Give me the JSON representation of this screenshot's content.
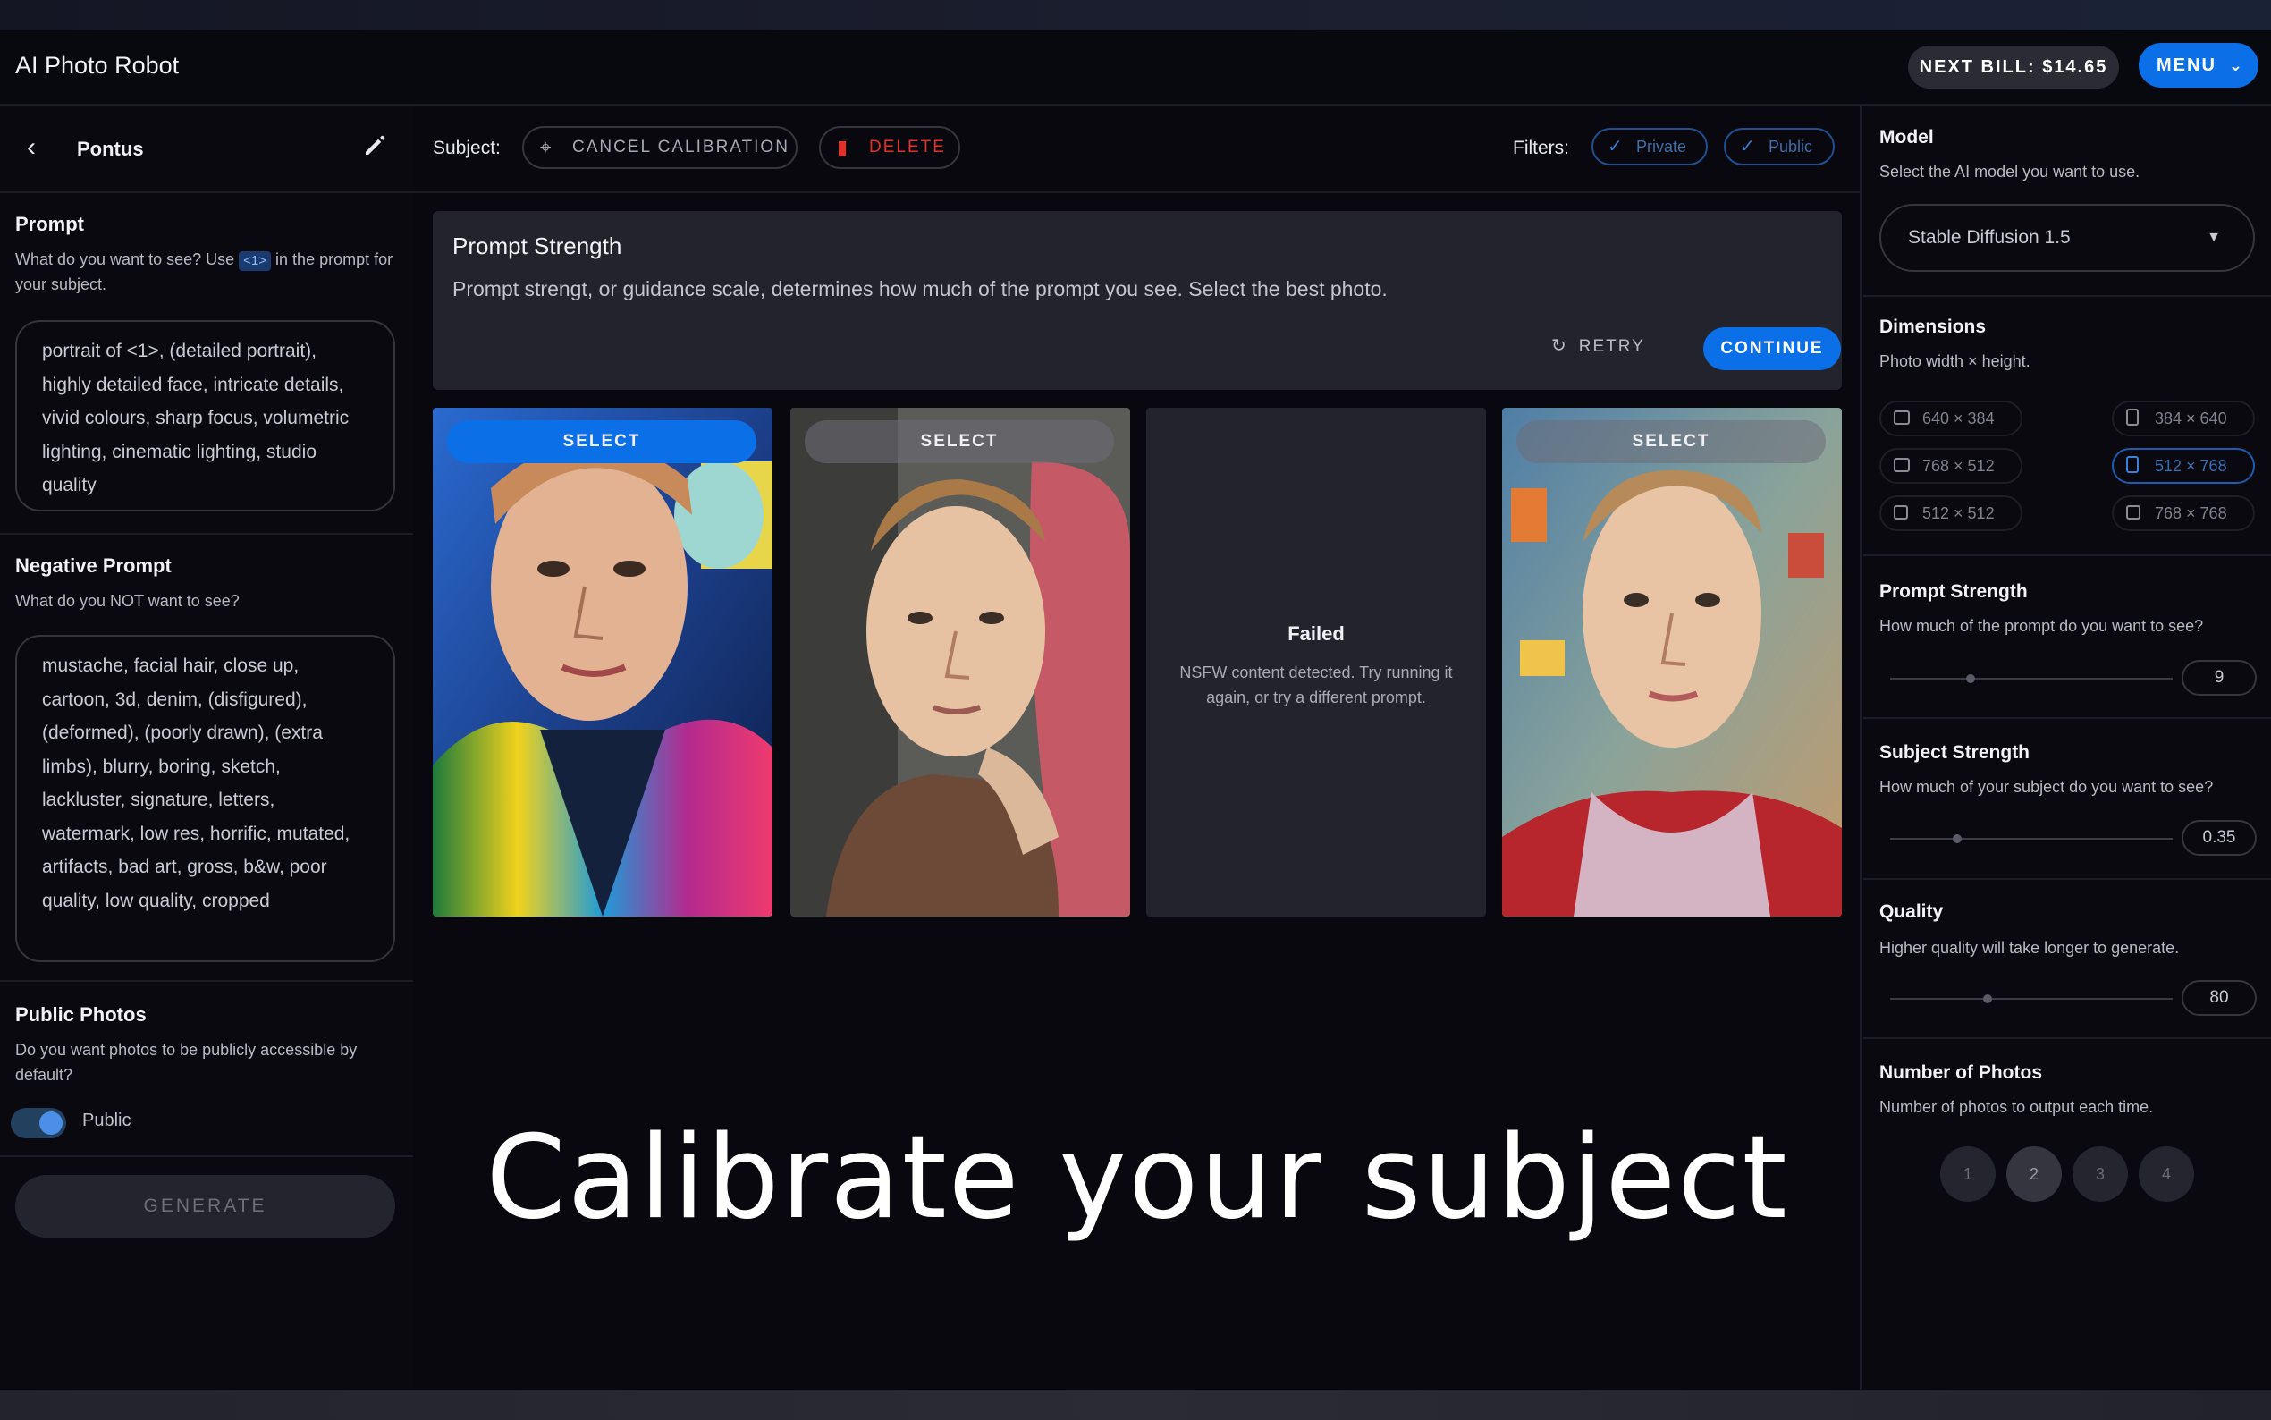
{
  "app": {
    "title": "AI Photo Robot"
  },
  "header": {
    "next_bill": "NEXT BILL: $14.65",
    "menu_label": "MENU"
  },
  "left": {
    "subject_name": "Pontus",
    "prompt": {
      "title": "Prompt",
      "desc_before": "What do you want to see? Use",
      "token": "<1>",
      "desc_after": "in the prompt for your subject.",
      "value": "portrait of <1>, (detailed portrait), highly detailed face, intricate details, vivid colours, sharp focus, volumetric lighting, cinematic lighting, studio quality"
    },
    "negative": {
      "title": "Negative Prompt",
      "desc": "What do you NOT want to see?",
      "value": "mustache, facial hair, close up, cartoon, 3d, denim, (disfigured), (deformed), (poorly drawn), (extra limbs), blurry, boring, sketch, lackluster, signature, letters, watermark, low res, horrific, mutated, artifacts, bad art, gross, b&w, poor quality, low quality, cropped"
    },
    "public": {
      "title": "Public Photos",
      "desc": "Do you want photos to be publicly accessible by default?",
      "toggle_label": "Public",
      "enabled": true
    },
    "generate_label": "GENERATE"
  },
  "center": {
    "subject_label": "Subject:",
    "cancel_label": "CANCEL CALIBRATION",
    "delete_label": "DELETE",
    "filters_label": "Filters:",
    "filters": [
      "Private",
      "Public"
    ],
    "card": {
      "title": "Prompt Strength",
      "desc": "Prompt strengt, or guidance scale, determines how much of the prompt you see. Select the best photo.",
      "retry_label": "RETRY",
      "continue_label": "CONTINUE"
    },
    "select_label": "SELECT",
    "failed": {
      "title": "Failed",
      "desc": "NSFW content detected. Try running it again, or try a different prompt."
    },
    "headline": "Calibrate your subject"
  },
  "right": {
    "model": {
      "title": "Model",
      "desc": "Select the AI model you want to use.",
      "value": "Stable Diffusion 1.5"
    },
    "dimensions": {
      "title": "Dimensions",
      "desc": "Photo width × height.",
      "options": [
        "640 × 384",
        "384 × 640",
        "768 × 512",
        "512 × 768",
        "512 × 512",
        "768 × 768"
      ],
      "selected": "512 × 768"
    },
    "prompt_strength": {
      "title": "Prompt Strength",
      "desc": "How much of the prompt do you want to see?",
      "value": "9",
      "fraction": 0.27
    },
    "subject_strength": {
      "title": "Subject Strength",
      "desc": "How much of your subject do you want to see?",
      "value": "0.35",
      "fraction": 0.22
    },
    "quality": {
      "title": "Quality",
      "desc": "Higher quality will take longer to generate.",
      "value": "80",
      "fraction": 0.33
    },
    "num_photos": {
      "title": "Number of Photos",
      "desc": "Number of photos to output each time.",
      "options": [
        "1",
        "2",
        "3",
        "4"
      ],
      "selected": "2"
    }
  },
  "colors": {
    "accent": "#0b6fe8",
    "danger": "#e0322b",
    "background": "#08080e"
  }
}
